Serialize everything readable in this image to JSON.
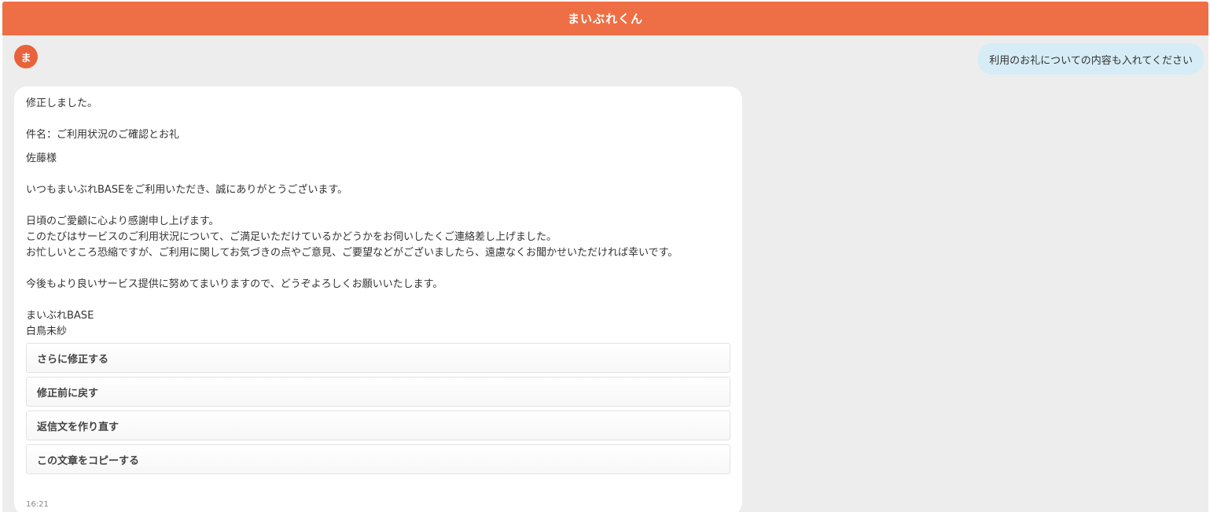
{
  "header": {
    "title": "まいぶれくん"
  },
  "avatar": {
    "initial": "ま"
  },
  "user_message": {
    "text": "利用のお礼についての内容も入れてください"
  },
  "bot_message": {
    "lines": {
      "l1": "修正しました。",
      "l2": "件名：ご利用状況のご確認とお礼",
      "l3": "佐藤様",
      "l4": "いつもまいぶれBASEをご利用いただき、誠にありがとうございます。",
      "l5": "日頃のご愛顧に心より感謝申し上げます。",
      "l6": "このたびはサービスのご利用状況について、ご満足いただけているかどうかをお伺いしたくご連絡差し上げました。",
      "l7": "お忙しいところ恐縮ですが、ご利用に関してお気づきの点やご意見、ご要望などがございましたら、遠慮なくお聞かせいただければ幸いです。",
      "l8": "今後もより良いサービス提供に努めてまいりますので、どうぞよろしくお願いいたします。",
      "l9": "まいぶれBASE",
      "l10": "白鳥未紗"
    },
    "actions": {
      "revise": "さらに修正する",
      "revert": "修正前に戻す",
      "regenerate": "返信文を作り直す",
      "copy": "この文章をコピーする"
    },
    "timestamp": "16:21"
  },
  "colors": {
    "header": "#ee6f45",
    "avatar": "#e8623b",
    "user_bubble": "#d6ecf6",
    "background": "#ededed"
  }
}
